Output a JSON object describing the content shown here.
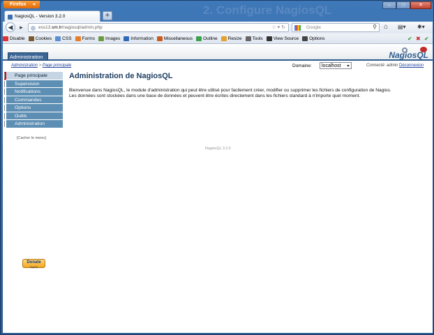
{
  "browser": {
    "firefox_label": "Firefox",
    "tab_title": "NagiosQL - Version 3.2.0",
    "url_pre": "ess13.",
    "url_host": "sm.tr",
    "url_rest": "/nagiosql/admin.php",
    "search_placeholder": "Google",
    "background_title": "2. Configure NagiosQL"
  },
  "toolbar": {
    "items": [
      {
        "label": "Disable",
        "color": "#d33"
      },
      {
        "label": "Cookies",
        "color": "#7a5a2e"
      },
      {
        "label": "CSS",
        "color": "#5a8fd1"
      },
      {
        "label": "Forms",
        "color": "#e77c2a"
      },
      {
        "label": "Images",
        "color": "#6c9a43"
      },
      {
        "label": "Information",
        "color": "#2f6ab8"
      },
      {
        "label": "Miscellaneous",
        "color": "#c95b1c"
      },
      {
        "label": "Outline",
        "color": "#3aa34a"
      },
      {
        "label": "Resize",
        "color": "#e3a02a"
      },
      {
        "label": "Tools",
        "color": "#666"
      },
      {
        "label": "View Source",
        "color": "#333"
      },
      {
        "label": "Options",
        "color": "#444"
      }
    ]
  },
  "app": {
    "admin_tab": "Administration",
    "logo_text": "NagiosQL",
    "breadcrumb_root": "Administration",
    "breadcrumb_sep": " > ",
    "breadcrumb_current": "Page principale",
    "domain_label": "Domaine:",
    "domain_value": "localhost",
    "connected_label": "Connecté: admin",
    "logout_label": "Déconnexion",
    "menu": [
      {
        "label": "Page principale",
        "active": true
      },
      {
        "label": "Supervision",
        "active": false
      },
      {
        "label": "Notifications",
        "active": false
      },
      {
        "label": "Commandes",
        "active": false
      },
      {
        "label": "Options",
        "active": false
      },
      {
        "label": "Outils",
        "active": false
      },
      {
        "label": "Administration",
        "active": false
      }
    ],
    "hide_menu": "[Cacher le menu]",
    "heading": "Administration de NagiosQL",
    "para1": "Bienvenue dans NagiosQL, le module d'administration qui peut être utilisé pour facilement créer, modifier ou supprimer les fichiers de configuration de Nagios.",
    "para2": "Les données sont stockées dans une base de données et peuvent être écrites directement dans les fichiers standard à n'importe quel moment.",
    "version": "NagiosQL 3.2.0",
    "donate_label": "Donate",
    "donate_sub": "PayPal"
  }
}
